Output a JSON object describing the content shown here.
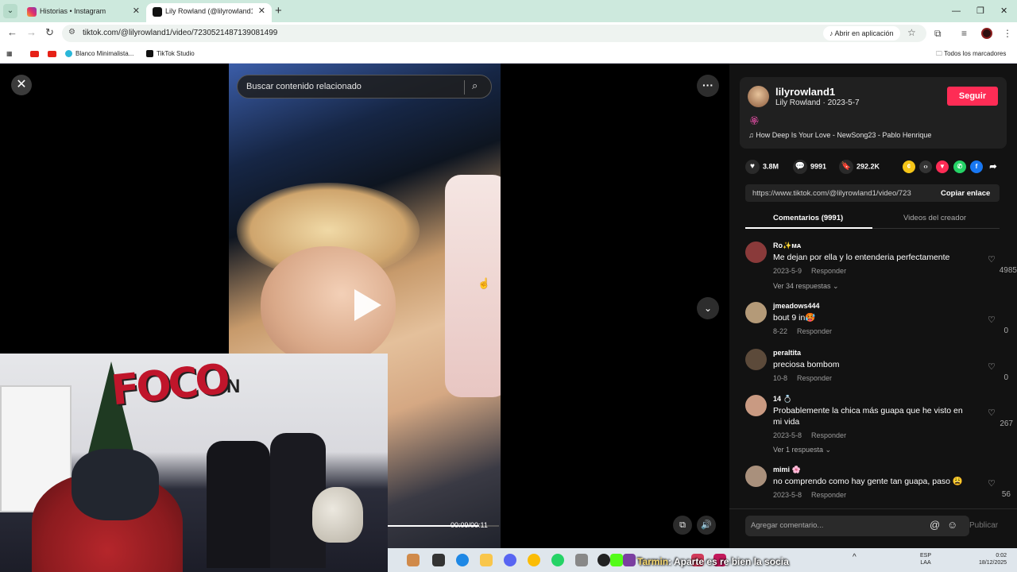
{
  "browser": {
    "tabs": [
      {
        "title": "Historias • Instagram",
        "favicon": "instagram-icon",
        "active": false
      },
      {
        "title": "Lily Rowland (@lilyrowland1) | T",
        "favicon": "tiktok-icon",
        "active": true
      }
    ],
    "url": "tiktok.com/@lilyrowland1/video/7230521487139081499",
    "open_in_app": "Abrir en aplicación",
    "bookmarks": [
      {
        "label": "",
        "icon": "youtube-icon"
      },
      {
        "label": "",
        "icon": "youtube-icon"
      },
      {
        "label": "Blanco Minimalista...",
        "icon": "canva-icon"
      },
      {
        "label": "TikTok Studio",
        "icon": "tiktok-icon"
      }
    ],
    "all_bookmarks": "Todos los marcadores"
  },
  "player": {
    "search_placeholder": "Buscar contenido relacionado",
    "progress": 0.82,
    "time": "00:09/00:11"
  },
  "creator": {
    "username": "lilyrowland1",
    "display": "Lily Rowland · 2023-5-7",
    "follow": "Seguir",
    "emoji": "🏵",
    "music": "How Deep Is Your Love - NewSong23 - Pablo Henrique"
  },
  "stats": {
    "likes": "3.8M",
    "comments": "9991",
    "saves": "292.2K"
  },
  "link": {
    "url": "https://www.tiktok.com/@lilyrowland1/video/7230...",
    "copy": "Copiar enlace"
  },
  "tabs": {
    "comments": "Comentarios (9991)",
    "videos": "Videos del creador"
  },
  "comments": [
    {
      "name": "Ro✨ᴍᴀ",
      "text": "Me dejan por ella y lo entenderia perfectamente",
      "date": "2023-5-9",
      "reply": "Responder",
      "likes": "4985",
      "replies": "Ver 34 respuestas ⌄",
      "color": "#8a3a3a"
    },
    {
      "name": "jmeadows444",
      "text": "bout 9 in🥵",
      "date": "8-22",
      "reply": "Responder",
      "likes": "0",
      "replies": "",
      "color": "#b49a78"
    },
    {
      "name": "peraltita",
      "text": "preciosa bombom",
      "date": "10-8",
      "reply": "Responder",
      "likes": "0",
      "replies": "",
      "color": "#5c4a3a"
    },
    {
      "name": "14 💍",
      "text": "Probablemente la chica más guapa que he visto en mi vida",
      "date": "2023-5-8",
      "reply": "Responder",
      "likes": "267",
      "replies": "Ver 1 respuesta ⌄",
      "color": "#c99a82"
    },
    {
      "name": "mimi 🌸",
      "text": "no comprendo como hay gente tan guapa, paso 😩",
      "date": "2023-5-8",
      "reply": "Responder",
      "likes": "56",
      "replies": "",
      "color": "#a9907c"
    }
  ],
  "comment_box": {
    "placeholder": "Agregar comentario...",
    "publish": "Publicar"
  },
  "stream_ticker": {
    "name": "Tarmin",
    "message": ": Aparte es re bien la socia"
  },
  "taskbar": {
    "lang": "ESP",
    "region": "LAA",
    "time": "0:02",
    "date": "18/12/2025"
  }
}
